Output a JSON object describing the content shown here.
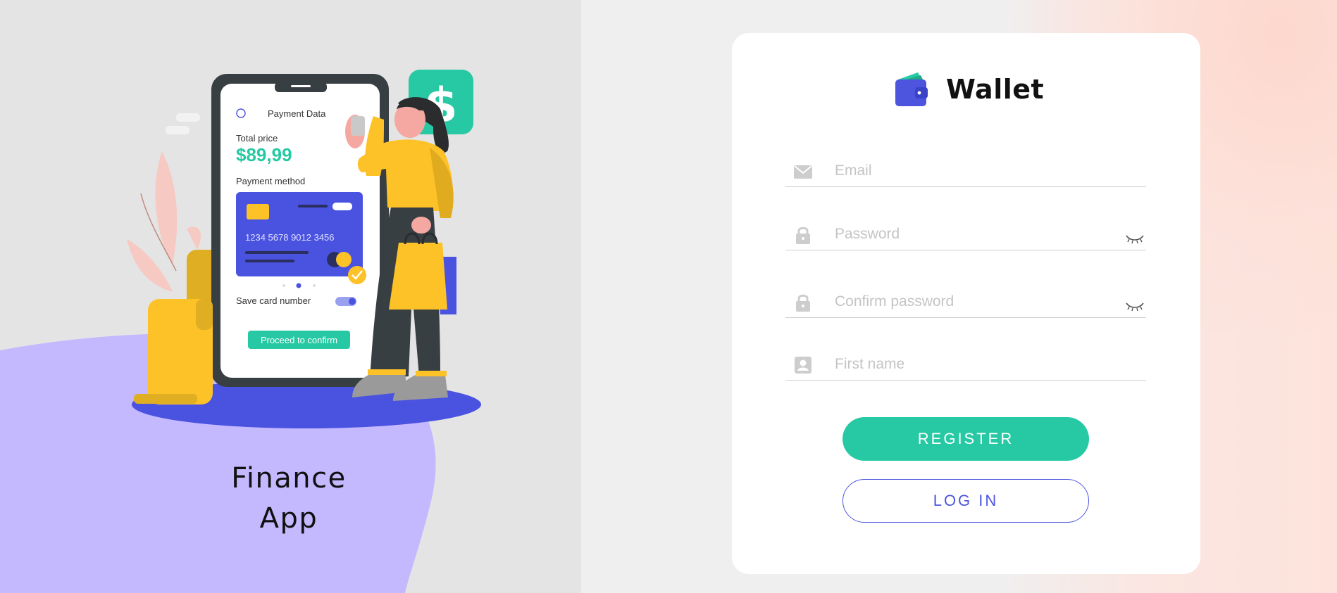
{
  "hero": {
    "title_line1": "Finance",
    "title_line2": "App",
    "phone": {
      "header": "Payment Data",
      "total_label": "Total price",
      "total_value": "$89,99",
      "method_label": "Payment method",
      "card_number": "1234  5678  9012  3456",
      "save_label": "Save card number",
      "confirm_label": "Proceed to confirm"
    },
    "dollar_glyph": "$"
  },
  "brand": {
    "name": "Wallet",
    "icon": "wallet-icon"
  },
  "form": {
    "email": {
      "placeholder": "Email",
      "icon": "envelope-icon"
    },
    "password": {
      "placeholder": "Password",
      "icon": "lock-icon",
      "toggle_icon": "eye-closed-icon"
    },
    "confirm_password": {
      "placeholder": "Confirm password",
      "icon": "lock-icon",
      "toggle_icon": "eye-closed-icon"
    },
    "first_name": {
      "placeholder": "First name",
      "icon": "contact-card-icon"
    }
  },
  "buttons": {
    "register": "REGISTER",
    "login": "LOG IN"
  },
  "colors": {
    "accent_green": "#26c9a3",
    "accent_blue": "#4d55df",
    "blob_purple": "#c4b8ff",
    "card_blue": "#4a52e0",
    "yellow": "#fdc228"
  }
}
